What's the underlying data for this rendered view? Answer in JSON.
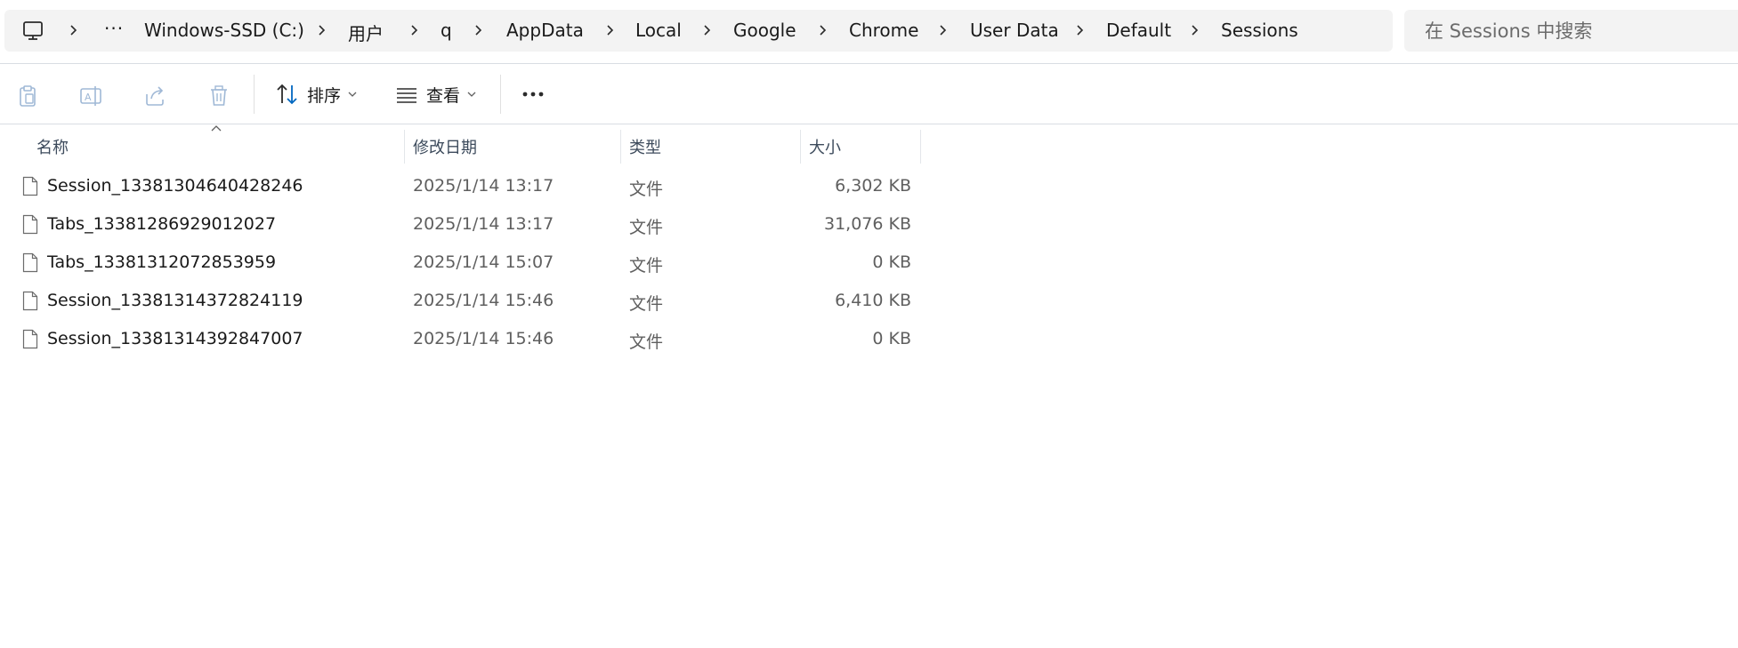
{
  "breadcrumb": {
    "icon": "computer-icon",
    "more": "···",
    "items": [
      {
        "label": "Windows-SSD (C:)"
      },
      {
        "label": "用户"
      },
      {
        "label": "q"
      },
      {
        "label": "AppData"
      },
      {
        "label": "Local"
      },
      {
        "label": "Google"
      },
      {
        "label": "Chrome"
      },
      {
        "label": "User Data"
      },
      {
        "label": "Default"
      },
      {
        "label": "Sessions"
      }
    ]
  },
  "search": {
    "placeholder": "在 Sessions 中搜索",
    "value": ""
  },
  "toolbar": {
    "copy_icon": "clipboard-icon",
    "rename_icon": "rename-icon",
    "share_icon": "share-icon",
    "delete_icon": "trash-icon",
    "sort_label": "排序",
    "view_label": "查看",
    "more_label": "···"
  },
  "columns": {
    "name": "名称",
    "date": "修改日期",
    "type": "类型",
    "size": "大小"
  },
  "files": [
    {
      "name": "Session_13381304640428246",
      "date": "2025/1/14 13:17",
      "type": "文件",
      "size": "6,302 KB"
    },
    {
      "name": "Tabs_13381286929012027",
      "date": "2025/1/14 13:17",
      "type": "文件",
      "size": "31,076 KB"
    },
    {
      "name": "Tabs_13381312072853959",
      "date": "2025/1/14 15:07",
      "type": "文件",
      "size": "0 KB"
    },
    {
      "name": "Session_13381314372824119",
      "date": "2025/1/14 15:46",
      "type": "文件",
      "size": "6,410 KB"
    },
    {
      "name": "Session_13381314392847007",
      "date": "2025/1/14 15:46",
      "type": "文件",
      "size": "0 KB"
    }
  ],
  "colors": {
    "accent": "#0067c0",
    "disabled_icon": "#9fb8d6",
    "header_text": "#3d4b5c"
  }
}
